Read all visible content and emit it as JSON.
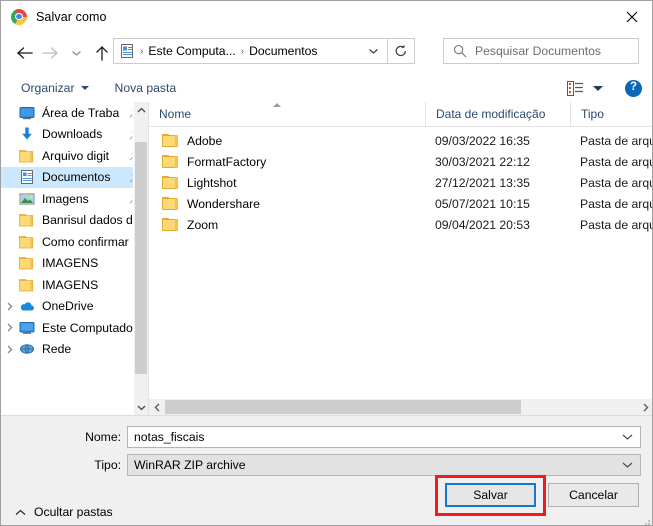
{
  "window": {
    "title": "Salvar como",
    "app_icon": "chrome-icon",
    "close_label": "✕"
  },
  "nav": {
    "back_icon": "arrow-left-icon",
    "forward_icon": "arrow-right-icon",
    "recent_icon": "chevron-down-icon",
    "up_icon": "arrow-up-icon",
    "breadcrumb_icon": "documents-icon",
    "breadcrumb": [
      "Este Computa...",
      "Documentos"
    ],
    "separator": "›",
    "dropdown_icon": "chevron-down-icon",
    "refresh_icon": "refresh-icon"
  },
  "search": {
    "icon": "search-icon",
    "placeholder": "Pesquisar Documentos",
    "value": ""
  },
  "toolbar": {
    "organize_label": "Organizar",
    "new_folder_label": "Nova pasta",
    "view_icon": "view-list-icon",
    "view_caret_icon": "chevron-down-icon",
    "help_icon": "help-icon",
    "help_glyph": "?"
  },
  "sidebar": {
    "items": [
      {
        "label": "Área de Traba",
        "icon": "desktop-icon",
        "pinned": true,
        "expandable": false,
        "selected": false
      },
      {
        "label": "Downloads",
        "icon": "download-icon",
        "pinned": true,
        "expandable": false,
        "selected": false
      },
      {
        "label": "Arquivo digit",
        "icon": "folder-icon",
        "pinned": true,
        "expandable": false,
        "selected": false
      },
      {
        "label": "Documentos",
        "icon": "documents-icon",
        "pinned": true,
        "expandable": false,
        "selected": true
      },
      {
        "label": "Imagens",
        "icon": "pictures-icon",
        "pinned": true,
        "expandable": false,
        "selected": false
      },
      {
        "label": "Banrisul dados d",
        "icon": "folder-icon",
        "pinned": false,
        "expandable": false,
        "selected": false
      },
      {
        "label": "Como confirmar",
        "icon": "folder-icon",
        "pinned": false,
        "expandable": false,
        "selected": false
      },
      {
        "label": "IMAGENS",
        "icon": "folder-icon",
        "pinned": false,
        "expandable": false,
        "selected": false
      },
      {
        "label": "IMAGENS",
        "icon": "folder-icon",
        "pinned": false,
        "expandable": false,
        "selected": false
      },
      {
        "label": "OneDrive",
        "icon": "onedrive-icon",
        "pinned": false,
        "expandable": true,
        "selected": false
      },
      {
        "label": "Este Computador",
        "icon": "computer-icon",
        "pinned": false,
        "expandable": true,
        "selected": false
      },
      {
        "label": "Rede",
        "icon": "network-icon",
        "pinned": false,
        "expandable": true,
        "selected": false
      }
    ],
    "scroll_up_icon": "chevron-up-icon",
    "scroll_down_icon": "chevron-down-icon"
  },
  "filelist": {
    "columns": [
      "Nome",
      "Data de modificação",
      "Tipo"
    ],
    "sort_indicator": "sort-ascending-icon",
    "rows": [
      {
        "name": "Adobe",
        "modified": "09/03/2022 16:35",
        "type": "Pasta de arqu",
        "icon": "folder-icon"
      },
      {
        "name": "FormatFactory",
        "modified": "30/03/2021 22:12",
        "type": "Pasta de arqu",
        "icon": "folder-icon"
      },
      {
        "name": "Lightshot",
        "modified": "27/12/2021 13:35",
        "type": "Pasta de arqu",
        "icon": "folder-icon"
      },
      {
        "name": "Wondershare",
        "modified": "05/07/2021 10:15",
        "type": "Pasta de arqu",
        "icon": "folder-icon"
      },
      {
        "name": "Zoom",
        "modified": "09/04/2021 20:53",
        "type": "Pasta de arqu",
        "icon": "folder-icon"
      }
    ],
    "hscroll_left_icon": "chevron-left-icon",
    "hscroll_right_icon": "chevron-right-icon"
  },
  "form": {
    "name_label": "Nome:",
    "name_value": "notas_fiscais",
    "type_label": "Tipo:",
    "type_value": "WinRAR ZIP archive",
    "combo_icon": "chevron-down-icon",
    "hide_folders_label": "Ocultar pastas",
    "hide_folders_icon": "chevron-up-icon"
  },
  "buttons": {
    "save_label": "Salvar",
    "cancel_label": "Cancelar"
  },
  "colors": {
    "accent_blue": "#1778d0",
    "highlight_red": "#ee1c1c",
    "selection_blue": "#cce8ff",
    "header_text": "#2b4a6f",
    "folder_yellow": "#fcd975"
  }
}
